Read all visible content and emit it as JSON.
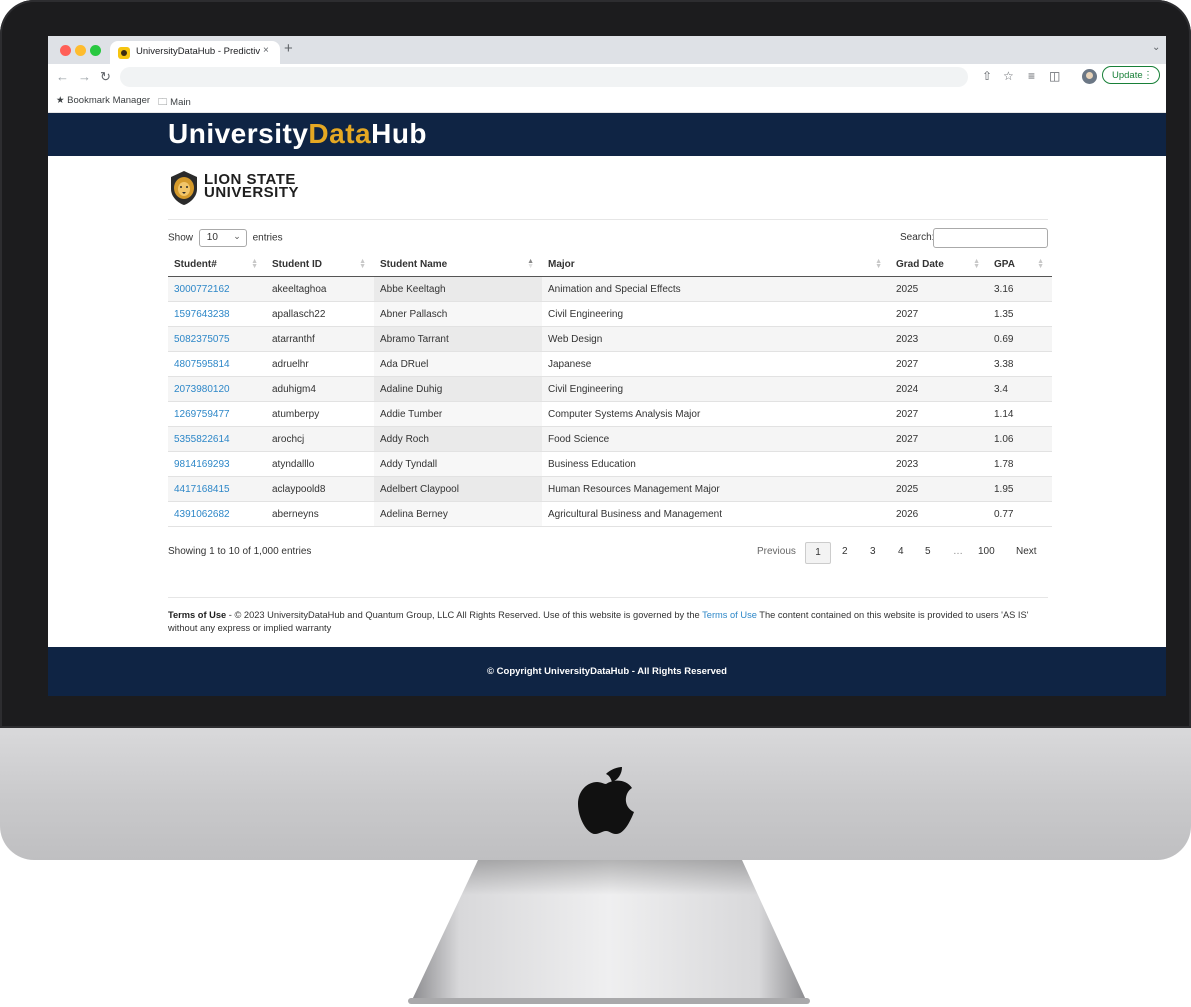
{
  "browser": {
    "tab_title": "UniversityDataHub - Predictive",
    "tab_close": "×",
    "new_tab": "+",
    "update_label": "Update",
    "bookmarks": [
      "Bookmark Manager",
      "Main"
    ]
  },
  "site": {
    "brand_part1": "University",
    "brand_part2": "Data",
    "brand_part3": "Hub",
    "logo_line1": "LION STATE",
    "logo_line2": "UNIVERSITY"
  },
  "table_controls": {
    "show_label": "Show",
    "entries_label": "entries",
    "length_value": "10",
    "search_label": "Search:"
  },
  "table": {
    "columns": [
      "Student#",
      "Student ID",
      "Student Name",
      "Major",
      "Grad Date",
      "GPA"
    ],
    "rows": [
      [
        "3000772162",
        "akeeltaghoa",
        "Abbe Keeltagh",
        "Animation and Special Effects",
        "2025",
        "3.16"
      ],
      [
        "1597643238",
        "apallasch22",
        "Abner Pallasch",
        "Civil Engineering",
        "2027",
        "1.35"
      ],
      [
        "5082375075",
        "atarranthf",
        "Abramo Tarrant",
        "Web Design",
        "2023",
        "0.69"
      ],
      [
        "4807595814",
        "adruelhr",
        "Ada DRuel",
        "Japanese",
        "2027",
        "3.38"
      ],
      [
        "2073980120",
        "aduhigm4",
        "Adaline Duhig",
        "Civil Engineering",
        "2024",
        "3.4"
      ],
      [
        "1269759477",
        "atumberpy",
        "Addie Tumber",
        "Computer Systems Analysis Major",
        "2027",
        "1.14"
      ],
      [
        "5355822614",
        "arochcj",
        "Addy Roch",
        "Food Science",
        "2027",
        "1.06"
      ],
      [
        "9814169293",
        "atyndalllo",
        "Addy Tyndall",
        "Business Education",
        "2023",
        "1.78"
      ],
      [
        "4417168415",
        "aclaypoold8",
        "Adelbert Claypool",
        "Human Resources Management Major",
        "2025",
        "1.95"
      ],
      [
        "4391062682",
        "aberneyns",
        "Adelina Berney",
        "Agricultural Business and Management",
        "2026",
        "0.77"
      ]
    ]
  },
  "pagination": {
    "info": "Showing 1 to 10 of 1,000 entries",
    "previous": "Previous",
    "pages": [
      "1",
      "2",
      "3",
      "4",
      "5",
      "…",
      "100"
    ],
    "current_page": "1",
    "next": "Next"
  },
  "terms": {
    "bold": "Terms of Use",
    "text1": " - © 2023 UniversityDataHub and Quantum Group, LLC All Rights Reserved. Use of this website is governed by the ",
    "link": "Terms of Use",
    "text2": " The content contained on this website is provided to users 'AS IS' without any express or implied warranty"
  },
  "footer": {
    "copyright": "© Copyright UniversityDataHub - All Rights Reserved"
  },
  "colors": {
    "navy": "#0f2444",
    "gold": "#e5a823",
    "link": "#2d87c8"
  }
}
